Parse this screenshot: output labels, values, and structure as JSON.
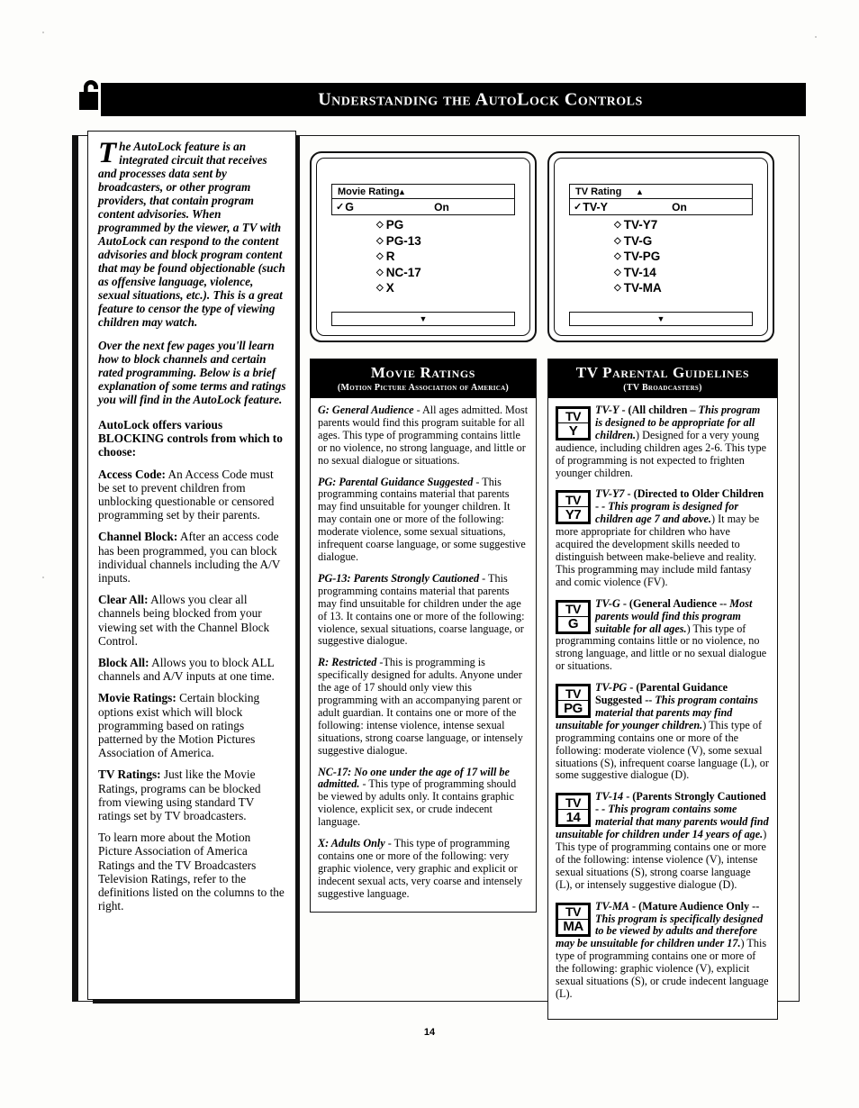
{
  "header": {
    "title": "Understanding the AutoLock Controls",
    "lock_icon": "open-padlock-icon"
  },
  "page_number": "14",
  "left_column": {
    "dropcap": "T",
    "intro_paragraph": "he AutoLock feature is an integrated circuit that receives and processes data sent by broadcasters, or other program providers, that contain program content advisories. When programmed by the viewer, a TV with AutoLock can respond to the content advisories and block program content that may be found objectionable (such as offensive language, violence, sexual situations, etc.). This is a great feature to censor the type of viewing children may watch.",
    "intro_paragraph_2": "Over the next few pages you'll learn how to block channels and certain rated programming. Below is a brief explanation of some terms and ratings you will find in the AutoLock feature.",
    "blocking_heading": "AutoLock offers various BLOCKING controls from which to choose:",
    "terms": [
      {
        "term": "Access Code:",
        "body": " An Access Code must be set to prevent children from unblocking questionable or censored programming set by their parents."
      },
      {
        "term": "Channel Block:",
        "body": " After an access code has been programmed, you can block individual channels including the A/V inputs."
      },
      {
        "term": "Clear All:",
        "body": " Allows you clear all channels being blocked from your viewing set with the Channel Block Control."
      },
      {
        "term": "Block All:",
        "body": " Allows you to block ALL channels and A/V inputs at one time."
      },
      {
        "term": "Movie Ratings:",
        "body": " Certain blocking options exist which will block programming based on ratings patterned by the Motion Pictures Association of America."
      },
      {
        "term": "TV Ratings:",
        "body": " Just like the Movie Ratings, programs can be blocked from viewing using standard TV ratings set by TV broadcasters."
      }
    ],
    "closing_paragraph": "To learn more about the Motion Picture Association of America Ratings and the TV Broadcasters Television Ratings, refer to the definitions listed on the columns to the right."
  },
  "movie_screen": {
    "menu_title": "Movie Rating",
    "up_arrow": "▲",
    "down_arrow": "▼",
    "selected_check": "✓",
    "selected_label": "G",
    "selected_value": "On",
    "diamond": "◇",
    "options": [
      "PG",
      "PG-13",
      "R",
      "NC-17",
      "X"
    ]
  },
  "tv_screen": {
    "menu_title": "TV Rating",
    "up_arrow": "▲",
    "down_arrow": "▼",
    "selected_check": "✓",
    "selected_label": "TV-Y",
    "selected_value": "On",
    "diamond": "◇",
    "options": [
      "TV-Y7",
      "TV-G",
      "TV-PG",
      "TV-14",
      "TV-MA"
    ]
  },
  "movie_ratings": {
    "heading": "Movie Ratings",
    "subheading": "(Motion Picture Association of America)",
    "entries": [
      {
        "lead": "G: General Audience",
        "body": " - All ages admitted. Most parents would find this program suitable for all ages. This type of programming contains little or no violence, no strong language, and little or no sexual dialogue or situations."
      },
      {
        "lead": "PG: Parental Guidance Suggested",
        "body": " - This programming contains material that parents may find unsuitable for younger children. It may contain one or more of the following: moderate violence, some sexual situations, infrequent coarse language, or some suggestive dialogue."
      },
      {
        "lead": "PG-13: Parents Strongly Cautioned",
        "body": " - This programming contains material that parents may find unsuitable for children under the age of 13. It contains one or more of the following: violence, sexual situations, coarse language, or suggestive dialogue."
      },
      {
        "lead": "R: Restricted",
        "body": " -This is programming is specifically designed for adults.  Anyone under the age of 17 should only view this programming with an accompanying parent or adult guardian. It contains one or more of the following: intense violence, intense sexual situations, strong coarse language, or intensely suggestive dialogue."
      },
      {
        "lead": "NC-17: No one under the age of 17 will be admitted.",
        "body": " - This type of programming should be viewed by adults only. It contains graphic violence, explicit sex, or crude indecent language."
      },
      {
        "lead": "X: Adults Only",
        "body": " - This type of programming contains one or more of the following: very graphic violence, very graphic and explicit or indecent sexual acts, very coarse and intensely suggestive language."
      }
    ]
  },
  "tv_guidelines": {
    "heading": "TV Parental Guidelines",
    "subheading": "(TV Broadcasters)",
    "entries": [
      {
        "icon_top": "TV",
        "icon_bottom": "Y",
        "icon_name": "tv-y-rating-icon",
        "lead": "TV-Y",
        "bold_part": " - (All children – ",
        "italic_part": "This program is designed to be appropriate for all children.",
        "rest": ") Designed for a very young audience, including children ages 2-6. This type of programming is not expected to frighten younger children."
      },
      {
        "icon_top": "TV",
        "icon_bottom": "Y7",
        "icon_name": "tv-y7-rating-icon",
        "lead": "TV-Y7",
        "bold_part": " - (Directed to Older Children - ",
        "italic_part": "- This program is designed for children age 7 and above.",
        "rest": ") It may be more appropriate for children who have acquired the development skills needed to distinguish between make-believe and reality. This programming may include mild fantasy and comic violence (FV)."
      },
      {
        "icon_top": "TV",
        "icon_bottom": "G",
        "icon_name": "tv-g-rating-icon",
        "lead": "TV-G",
        "bold_part": " - (General Audience -- ",
        "italic_part": "Most parents would find this program suitable for all ages.",
        "rest": ") This type of programming contains little or no violence, no strong language, and little or no sexual dialogue or situations."
      },
      {
        "icon_top": "TV",
        "icon_bottom": "PG",
        "icon_name": "tv-pg-rating-icon",
        "lead": "TV-PG",
        "bold_part": " - (Parental Guidance Suggested -- ",
        "italic_part": "This program contains material that parents may find unsuitable for younger children.",
        "rest": ") This type of programming contains one or more of the following: moderate violence (V), some sexual situations (S), infrequent coarse language (L), or some suggestive dialogue (D)."
      },
      {
        "icon_top": "TV",
        "icon_bottom": "14",
        "icon_name": "tv-14-rating-icon",
        "lead": "TV-14",
        "bold_part": " - (Parents Strongly Cautioned - ",
        "italic_part": "- This program contains some material that many parents would find unsuitable for children under 14 years of age.",
        "rest": ") This type of programming contains one or more of the following: intense violence (V), intense sexual situations (S), strong coarse language (L), or intensely suggestive dialogue (D)."
      },
      {
        "icon_top": "TV",
        "icon_bottom": "MA",
        "icon_name": "tv-ma-rating-icon",
        "lead": "TV-MA",
        "bold_part": " - (Mature Audience Only -- ",
        "italic_part": "This program is specifically designed to be viewed by adults and therefore may be unsuitable for children under 17.",
        "rest": ") This type of programming contains one or more of the following: graphic violence (V), explicit sexual situations (S), or crude indecent language (L)."
      }
    ]
  }
}
